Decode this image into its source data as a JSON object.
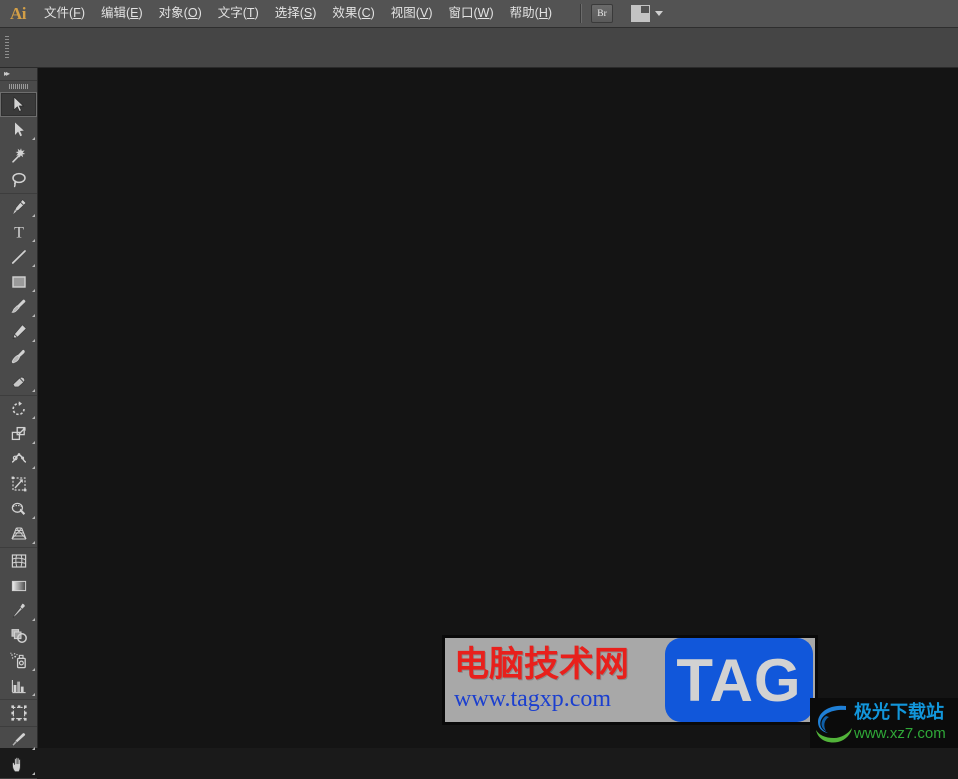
{
  "app": {
    "name": "Adobe Illustrator",
    "logo_text": "Ai"
  },
  "menubar": {
    "items": [
      {
        "label": "文件(F)",
        "text": "文件(",
        "mnemonic": "F",
        "tail": ")",
        "name": "menu-file"
      },
      {
        "label": "编辑(E)",
        "text": "编辑(",
        "mnemonic": "E",
        "tail": ")",
        "name": "menu-edit"
      },
      {
        "label": "对象(O)",
        "text": "对象(",
        "mnemonic": "O",
        "tail": ")",
        "name": "menu-object"
      },
      {
        "label": "文字(T)",
        "text": "文字(",
        "mnemonic": "T",
        "tail": ")",
        "name": "menu-type"
      },
      {
        "label": "选择(S)",
        "text": "选择(",
        "mnemonic": "S",
        "tail": ")",
        "name": "menu-select"
      },
      {
        "label": "效果(C)",
        "text": "效果(",
        "mnemonic": "C",
        "tail": ")",
        "name": "menu-effect"
      },
      {
        "label": "视图(V)",
        "text": "视图(",
        "mnemonic": "V",
        "tail": ")",
        "name": "menu-view"
      },
      {
        "label": "窗口(W)",
        "text": "窗口(",
        "mnemonic": "W",
        "tail": ")",
        "name": "menu-window"
      },
      {
        "label": "帮助(H)",
        "text": "帮助(",
        "mnemonic": "H",
        "tail": ")",
        "name": "menu-help"
      }
    ],
    "bridge_button_label": "Br",
    "workspace_switcher_name": "workspace-switcher-icon"
  },
  "toolbar": {
    "collapse_label": "▸▸",
    "tools": [
      {
        "name": "selection-tool",
        "icon": "arrow-solid",
        "selected": true,
        "submenu": false
      },
      {
        "name": "direct-selection-tool",
        "icon": "arrow-direct",
        "selected": false,
        "submenu": true
      },
      {
        "name": "magic-wand-tool",
        "icon": "magic-wand",
        "selected": false,
        "submenu": false
      },
      {
        "name": "lasso-tool",
        "icon": "lasso",
        "selected": false,
        "submenu": false
      },
      {
        "name": "pen-tool",
        "icon": "pen",
        "selected": false,
        "submenu": true
      },
      {
        "name": "type-tool",
        "icon": "type-T",
        "selected": false,
        "submenu": true
      },
      {
        "name": "line-segment-tool",
        "icon": "line-segment",
        "selected": false,
        "submenu": true
      },
      {
        "name": "rectangle-tool",
        "icon": "rectangle",
        "selected": false,
        "submenu": true
      },
      {
        "name": "paintbrush-tool",
        "icon": "paintbrush",
        "selected": false,
        "submenu": true
      },
      {
        "name": "pencil-tool",
        "icon": "pencil",
        "selected": false,
        "submenu": true
      },
      {
        "name": "blob-brush-tool",
        "icon": "blob-brush",
        "selected": false,
        "submenu": false
      },
      {
        "name": "eraser-tool",
        "icon": "eraser",
        "selected": false,
        "submenu": true
      },
      {
        "name": "rotate-tool",
        "icon": "rotate",
        "selected": false,
        "submenu": true
      },
      {
        "name": "scale-tool",
        "icon": "scale",
        "selected": false,
        "submenu": true
      },
      {
        "name": "width-tool",
        "icon": "width-warp",
        "selected": false,
        "submenu": true
      },
      {
        "name": "free-transform-tool",
        "icon": "free-transform",
        "selected": false,
        "submenu": false
      },
      {
        "name": "shape-builder-tool",
        "icon": "shape-builder",
        "selected": false,
        "submenu": true
      },
      {
        "name": "perspective-grid-tool",
        "icon": "perspective-grid",
        "selected": false,
        "submenu": true
      },
      {
        "name": "mesh-tool",
        "icon": "mesh",
        "selected": false,
        "submenu": false
      },
      {
        "name": "gradient-tool",
        "icon": "gradient",
        "selected": false,
        "submenu": false
      },
      {
        "name": "eyedropper-tool",
        "icon": "eyedropper",
        "selected": false,
        "submenu": true
      },
      {
        "name": "blend-tool",
        "icon": "blend",
        "selected": false,
        "submenu": false
      },
      {
        "name": "symbol-sprayer-tool",
        "icon": "symbol-sprayer",
        "selected": false,
        "submenu": true
      },
      {
        "name": "column-graph-tool",
        "icon": "column-graph",
        "selected": false,
        "submenu": true
      },
      {
        "name": "artboard-tool",
        "icon": "artboard",
        "selected": false,
        "submenu": false
      },
      {
        "name": "slice-tool",
        "icon": "slice",
        "selected": false,
        "submenu": true
      },
      {
        "name": "hand-tool",
        "icon": "hand",
        "selected": false,
        "submenu": true
      }
    ],
    "group_breaks": [
      3,
      11,
      17,
      23,
      24
    ]
  },
  "canvas": {
    "background_color": "#141414",
    "document_open": false
  },
  "watermark": {
    "title": "电脑技术网",
    "url": "www.tagxp.com",
    "badge": "TAG",
    "title_color": "#e8201c",
    "url_color": "#1b3fcf",
    "badge_bg_color": "#1157da"
  },
  "xz7_badge": {
    "title": "极光下载站",
    "url": "www.xz7.com",
    "title_color": "#1296db",
    "url_color": "#2fa838"
  },
  "colors": {
    "menubar_bg": "#535353",
    "controlbar_bg": "#454545",
    "toolbar_bg": "#4a4a4a",
    "canvas_bg": "#141414",
    "accent": "#d39f47"
  }
}
